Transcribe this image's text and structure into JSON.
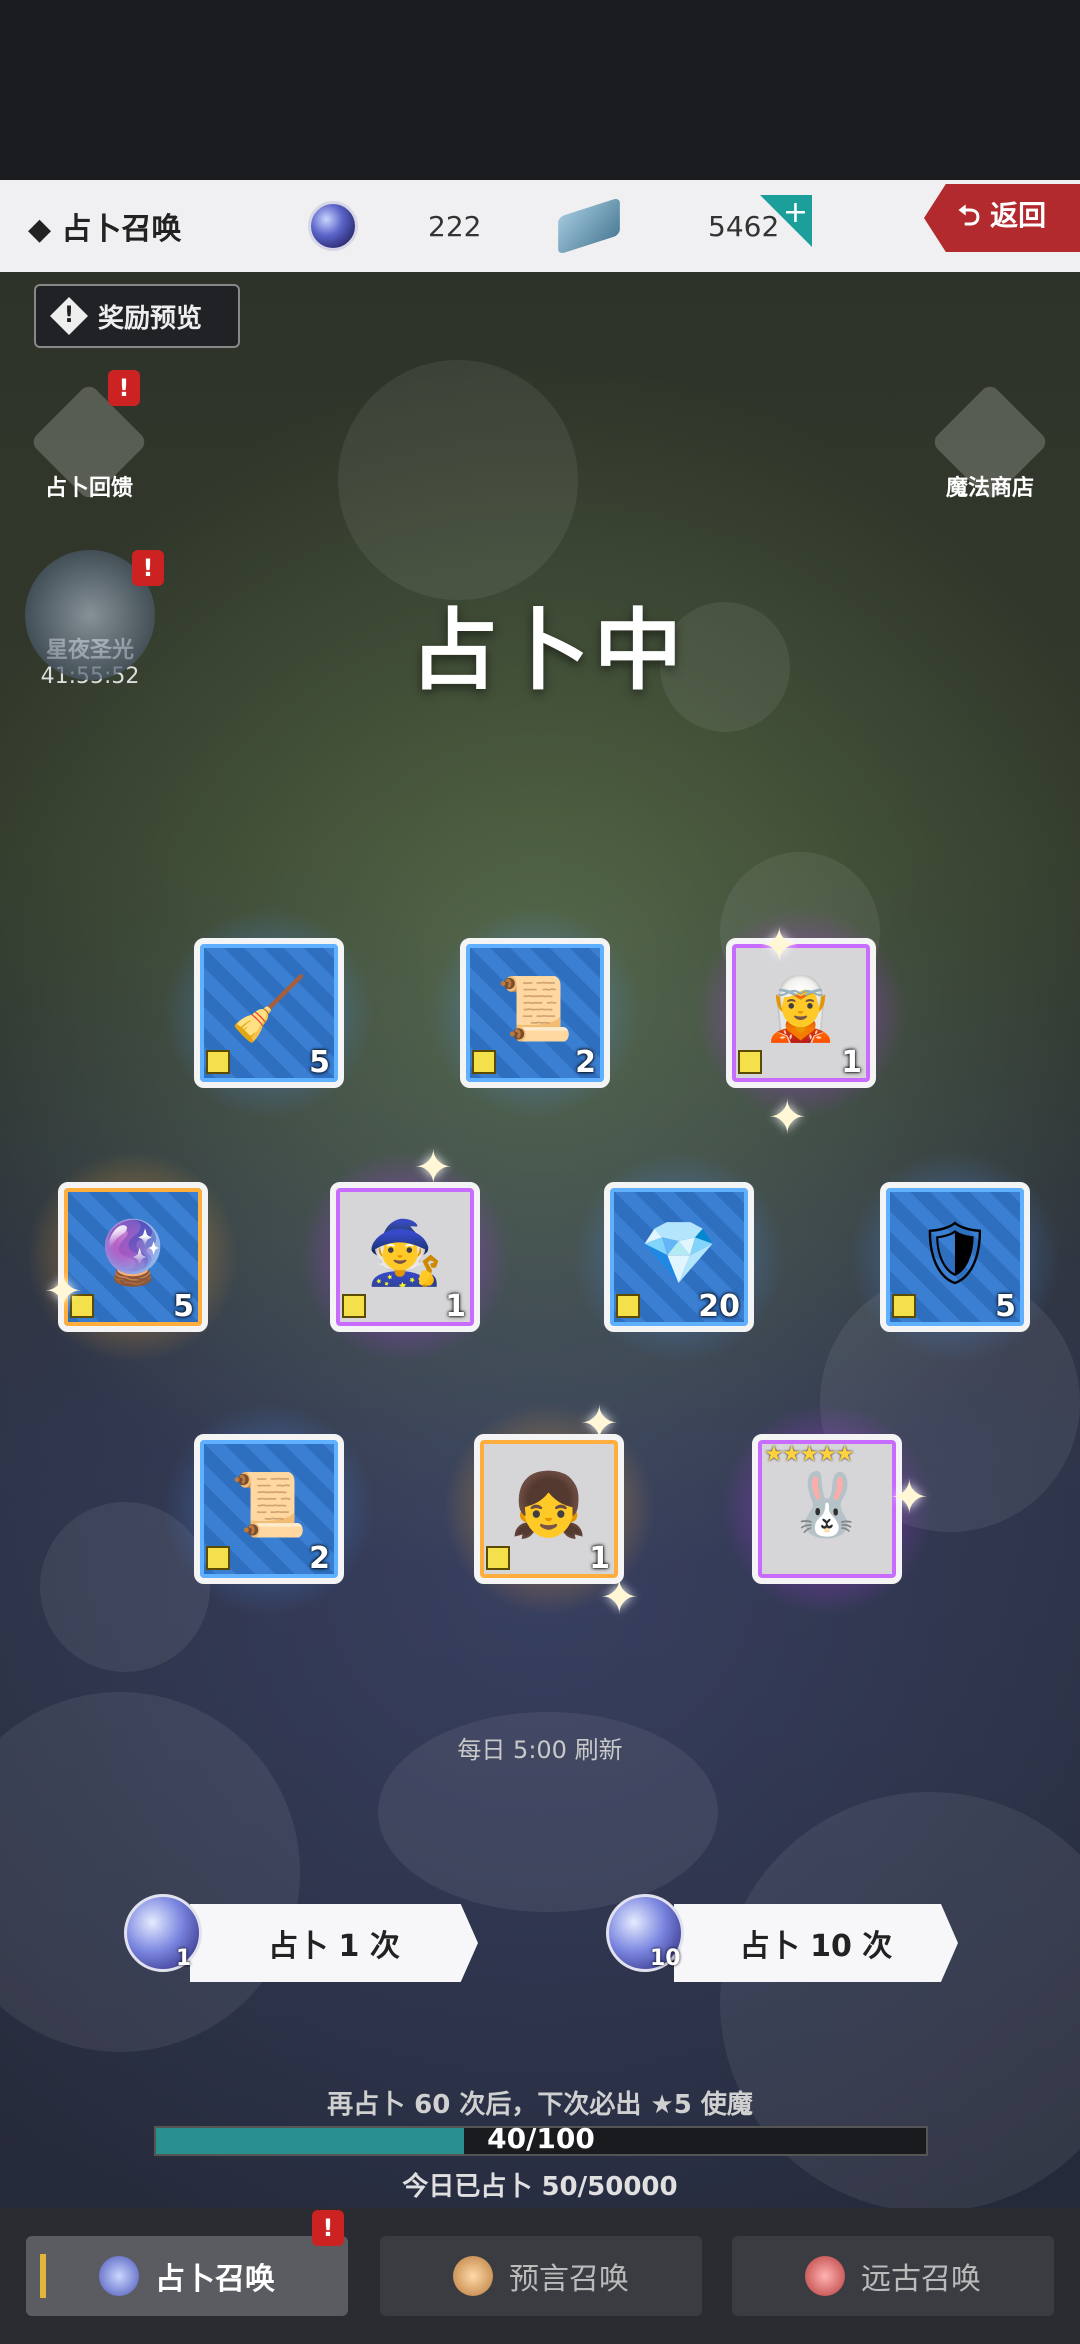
{
  "header": {
    "title": "◆ 占卜召唤",
    "orb_count": "222",
    "gem_count": "5462",
    "plus_label": "+",
    "back_label": "⮌ 返回"
  },
  "stage": {
    "reward_preview_label": "奖励预览",
    "feedback_label": "占卜回馈",
    "starnight_label": "星夜圣光",
    "starnight_timer": "41:55:52",
    "magic_shop_label": "魔法商店",
    "status_text": "占卜中",
    "refresh_text": "每日 5:00 刷新"
  },
  "results": [
    {
      "name": "broom",
      "icon": "🧹",
      "qty": "5",
      "rarity": "blue",
      "glyph": "broom-icon"
    },
    {
      "name": "blue-scroll",
      "icon": "📜",
      "qty": "2",
      "rarity": "blue",
      "glyph": "scroll-icon"
    },
    {
      "name": "character-flower-girl",
      "icon": "🧝",
      "qty": "1",
      "rarity": "purple",
      "glyph": "character-portrait-icon"
    },
    {
      "name": "gold-fragment",
      "icon": "🔮",
      "qty": "5",
      "rarity": "gold",
      "glyph": "fragment-icon"
    },
    {
      "name": "character-witch",
      "icon": "🧙",
      "qty": "1",
      "rarity": "purple",
      "glyph": "character-portrait-icon"
    },
    {
      "name": "purple-crystal",
      "icon": "💎",
      "qty": "20",
      "rarity": "blue",
      "glyph": "crystal-icon"
    },
    {
      "name": "shield",
      "icon": "🛡",
      "qty": "5",
      "rarity": "blue",
      "glyph": "shield-icon"
    },
    {
      "name": "blue-scroll-2",
      "icon": "📜",
      "qty": "2",
      "rarity": "blue",
      "glyph": "scroll-icon"
    },
    {
      "name": "character-white-hair",
      "icon": "👧",
      "qty": "1",
      "rarity": "gold",
      "glyph": "character-portrait-icon"
    },
    {
      "name": "rabbit-pet",
      "icon": "🐰",
      "qty": "",
      "rarity": "purple",
      "glyph": "rabbit-icon",
      "stars": "★★★★★"
    }
  ],
  "summon": {
    "once_label": "占卜 1 次",
    "once_cost": "1",
    "ten_label": "占卜 10 次",
    "ten_cost": "10"
  },
  "pity": {
    "text": "再占卜 60 次后，下次必出 ★5 使魔",
    "progress_label": "40/100",
    "progress_value": 0.4,
    "today_text": "今日已占卜 50/50000"
  },
  "nav": {
    "tab1": "占卜召唤",
    "tab2": "预言召唤",
    "tab3": "远古召唤"
  },
  "colors": {
    "accent_gold": "#e2b43a",
    "back_red": "#b32a2e",
    "progress_teal": "#2a8f8f"
  }
}
